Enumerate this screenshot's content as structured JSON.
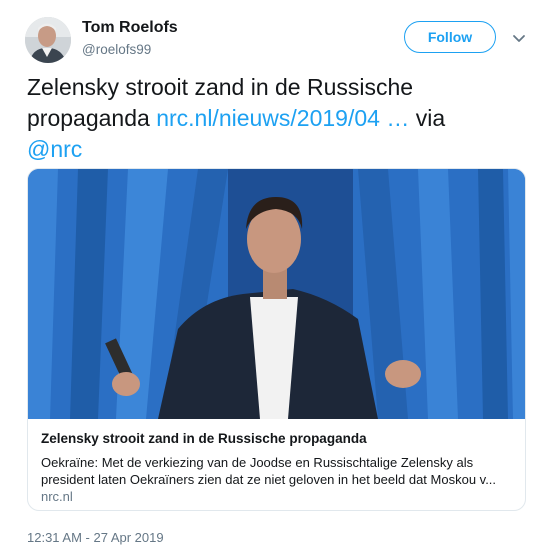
{
  "author": {
    "name": "Tom Roelofs",
    "handle": "@roelofs99",
    "avatar_icon": "user-photo"
  },
  "follow_button": {
    "label": "Follow"
  },
  "menu": {
    "icon": "chevron-down-icon"
  },
  "tweet": {
    "text_main": "Zelensky strooit zand in de Russische propaganda",
    "link": "nrc.nl/nieuws/2019/04",
    "ellipsis": "…",
    "via": "via",
    "mention": "@nrc"
  },
  "card": {
    "title": "Zelensky strooit zand in de Russische propaganda",
    "description": "Oekraïne: Met de verkiezing van de Joodse en Russischtalige Zelensky als president laten Oekraïners zien dat ze niet geloven in het beeld dat Moskou v...",
    "domain": "nrc.nl"
  },
  "timestamp": "12:31 AM - 27 Apr 2019",
  "colors": {
    "accent": "#1da1f2",
    "secondary_text": "#657786",
    "curtain_blue": "#2b6fc4"
  }
}
